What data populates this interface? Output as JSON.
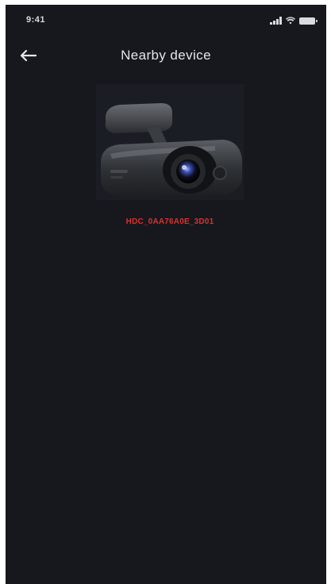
{
  "status_bar": {
    "time": "9:41",
    "icons": [
      "signal-icon",
      "wifi-icon",
      "battery-icon"
    ]
  },
  "nav": {
    "back_icon": "arrow-left-icon",
    "title": "Nearby device"
  },
  "device": {
    "name": "HDC_0AA76A0E_3D01",
    "image_icon": "dashcam-image",
    "name_color": "#d8322c"
  },
  "colors": {
    "background": "#16181d",
    "text": "#e4e6ea"
  }
}
